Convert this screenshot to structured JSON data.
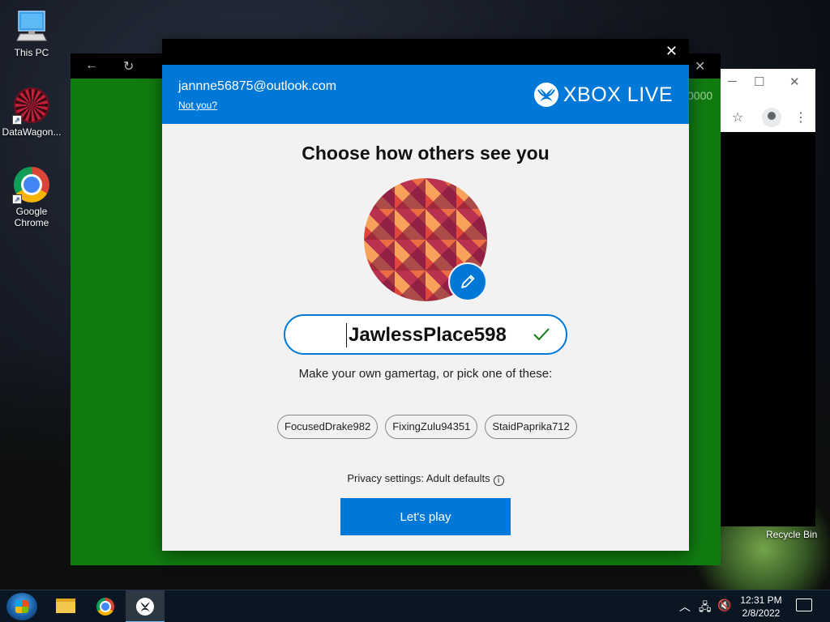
{
  "desktop": {
    "icons": [
      {
        "label": "This PC"
      },
      {
        "label": "DataWagon..."
      },
      {
        "label": "Google\nChrome"
      }
    ],
    "recycle_bin_label": "Recycle Bin"
  },
  "background_app": {
    "partial_text": "0000"
  },
  "dialog": {
    "email": "jannne56875@outlook.com",
    "not_you": "Not you?",
    "brand": "XBOX LIVE",
    "title": "Choose how others see you",
    "gamertag_value": "JawlessPlace598",
    "hint": "Make your own gamertag, or pick one of these:",
    "suggestions": [
      "FocusedDrake982",
      "FixingZulu94351",
      "StaidPaprika712"
    ],
    "privacy": "Privacy settings: Adult defaults",
    "play_button": "Let's play"
  },
  "taskbar": {
    "time": "12:31 PM",
    "date": "2/8/2022"
  },
  "colors": {
    "accent": "#0078d7",
    "xbox_green": "#107c10",
    "check_green": "#107c10"
  }
}
